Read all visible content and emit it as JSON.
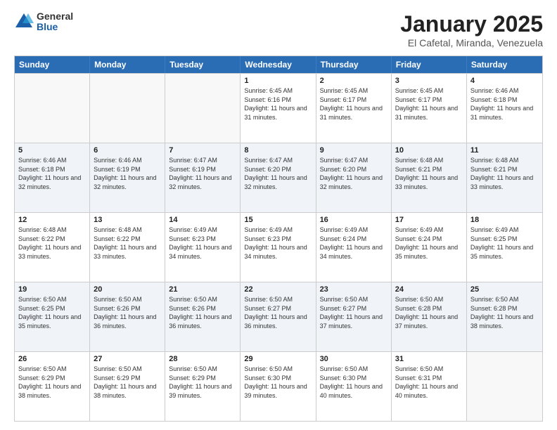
{
  "logo": {
    "general": "General",
    "blue": "Blue"
  },
  "header": {
    "month": "January 2025",
    "location": "El Cafetal, Miranda, Venezuela"
  },
  "days_of_week": [
    "Sunday",
    "Monday",
    "Tuesday",
    "Wednesday",
    "Thursday",
    "Friday",
    "Saturday"
  ],
  "weeks": [
    [
      {
        "day": "",
        "info": ""
      },
      {
        "day": "",
        "info": ""
      },
      {
        "day": "",
        "info": ""
      },
      {
        "day": "1",
        "info": "Sunrise: 6:45 AM\nSunset: 6:16 PM\nDaylight: 11 hours and 31 minutes."
      },
      {
        "day": "2",
        "info": "Sunrise: 6:45 AM\nSunset: 6:17 PM\nDaylight: 11 hours and 31 minutes."
      },
      {
        "day": "3",
        "info": "Sunrise: 6:45 AM\nSunset: 6:17 PM\nDaylight: 11 hours and 31 minutes."
      },
      {
        "day": "4",
        "info": "Sunrise: 6:46 AM\nSunset: 6:18 PM\nDaylight: 11 hours and 31 minutes."
      }
    ],
    [
      {
        "day": "5",
        "info": "Sunrise: 6:46 AM\nSunset: 6:18 PM\nDaylight: 11 hours and 32 minutes."
      },
      {
        "day": "6",
        "info": "Sunrise: 6:46 AM\nSunset: 6:19 PM\nDaylight: 11 hours and 32 minutes."
      },
      {
        "day": "7",
        "info": "Sunrise: 6:47 AM\nSunset: 6:19 PM\nDaylight: 11 hours and 32 minutes."
      },
      {
        "day": "8",
        "info": "Sunrise: 6:47 AM\nSunset: 6:20 PM\nDaylight: 11 hours and 32 minutes."
      },
      {
        "day": "9",
        "info": "Sunrise: 6:47 AM\nSunset: 6:20 PM\nDaylight: 11 hours and 32 minutes."
      },
      {
        "day": "10",
        "info": "Sunrise: 6:48 AM\nSunset: 6:21 PM\nDaylight: 11 hours and 33 minutes."
      },
      {
        "day": "11",
        "info": "Sunrise: 6:48 AM\nSunset: 6:21 PM\nDaylight: 11 hours and 33 minutes."
      }
    ],
    [
      {
        "day": "12",
        "info": "Sunrise: 6:48 AM\nSunset: 6:22 PM\nDaylight: 11 hours and 33 minutes."
      },
      {
        "day": "13",
        "info": "Sunrise: 6:48 AM\nSunset: 6:22 PM\nDaylight: 11 hours and 33 minutes."
      },
      {
        "day": "14",
        "info": "Sunrise: 6:49 AM\nSunset: 6:23 PM\nDaylight: 11 hours and 34 minutes."
      },
      {
        "day": "15",
        "info": "Sunrise: 6:49 AM\nSunset: 6:23 PM\nDaylight: 11 hours and 34 minutes."
      },
      {
        "day": "16",
        "info": "Sunrise: 6:49 AM\nSunset: 6:24 PM\nDaylight: 11 hours and 34 minutes."
      },
      {
        "day": "17",
        "info": "Sunrise: 6:49 AM\nSunset: 6:24 PM\nDaylight: 11 hours and 35 minutes."
      },
      {
        "day": "18",
        "info": "Sunrise: 6:49 AM\nSunset: 6:25 PM\nDaylight: 11 hours and 35 minutes."
      }
    ],
    [
      {
        "day": "19",
        "info": "Sunrise: 6:50 AM\nSunset: 6:25 PM\nDaylight: 11 hours and 35 minutes."
      },
      {
        "day": "20",
        "info": "Sunrise: 6:50 AM\nSunset: 6:26 PM\nDaylight: 11 hours and 36 minutes."
      },
      {
        "day": "21",
        "info": "Sunrise: 6:50 AM\nSunset: 6:26 PM\nDaylight: 11 hours and 36 minutes."
      },
      {
        "day": "22",
        "info": "Sunrise: 6:50 AM\nSunset: 6:27 PM\nDaylight: 11 hours and 36 minutes."
      },
      {
        "day": "23",
        "info": "Sunrise: 6:50 AM\nSunset: 6:27 PM\nDaylight: 11 hours and 37 minutes."
      },
      {
        "day": "24",
        "info": "Sunrise: 6:50 AM\nSunset: 6:28 PM\nDaylight: 11 hours and 37 minutes."
      },
      {
        "day": "25",
        "info": "Sunrise: 6:50 AM\nSunset: 6:28 PM\nDaylight: 11 hours and 38 minutes."
      }
    ],
    [
      {
        "day": "26",
        "info": "Sunrise: 6:50 AM\nSunset: 6:29 PM\nDaylight: 11 hours and 38 minutes."
      },
      {
        "day": "27",
        "info": "Sunrise: 6:50 AM\nSunset: 6:29 PM\nDaylight: 11 hours and 38 minutes."
      },
      {
        "day": "28",
        "info": "Sunrise: 6:50 AM\nSunset: 6:29 PM\nDaylight: 11 hours and 39 minutes."
      },
      {
        "day": "29",
        "info": "Sunrise: 6:50 AM\nSunset: 6:30 PM\nDaylight: 11 hours and 39 minutes."
      },
      {
        "day": "30",
        "info": "Sunrise: 6:50 AM\nSunset: 6:30 PM\nDaylight: 11 hours and 40 minutes."
      },
      {
        "day": "31",
        "info": "Sunrise: 6:50 AM\nSunset: 6:31 PM\nDaylight: 11 hours and 40 minutes."
      },
      {
        "day": "",
        "info": ""
      }
    ]
  ]
}
